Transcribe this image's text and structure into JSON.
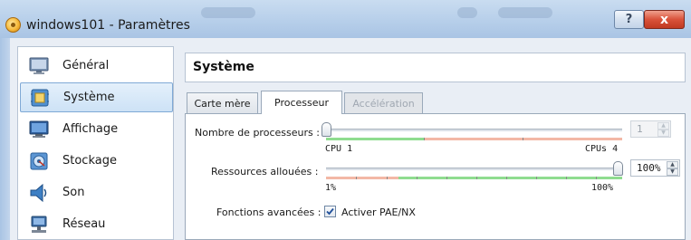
{
  "window": {
    "title": "windows101 - Paramètres",
    "help_label": "?",
    "close_label": "x",
    "colors": {
      "titlebar": "#b7cfea",
      "close": "#d9523a",
      "selection": "#cde2f6"
    }
  },
  "sidebar": {
    "items": [
      {
        "label": "Général",
        "icon": "general-monitor-icon",
        "selected": false
      },
      {
        "label": "Système",
        "icon": "system-chip-icon",
        "selected": true
      },
      {
        "label": "Affichage",
        "icon": "display-icon",
        "selected": false
      },
      {
        "label": "Stockage",
        "icon": "storage-icon",
        "selected": false
      },
      {
        "label": "Son",
        "icon": "speaker-icon",
        "selected": false
      },
      {
        "label": "Réseau",
        "icon": "network-icon",
        "selected": false
      }
    ]
  },
  "main": {
    "title": "Système",
    "tabs": [
      {
        "label": "Carte mère",
        "active": false,
        "enabled": true
      },
      {
        "label": "Processeur",
        "active": true,
        "enabled": true
      },
      {
        "label": "Accélération",
        "active": false,
        "enabled": false
      }
    ],
    "processors": {
      "label": "Nombre de processeurs :",
      "value": 1,
      "min": 1,
      "max": 4,
      "spin_value": "1",
      "spin_enabled": false,
      "min_label": "CPU 1",
      "max_label": "CPUs 4"
    },
    "resources": {
      "label": "Ressources allouées :",
      "value": 100,
      "min": 1,
      "max": 100,
      "spin_value": "100%",
      "min_label": "1%",
      "max_label": "100%"
    },
    "advanced": {
      "label": "Fonctions avancées :",
      "checkbox_label": "Activer PAE/NX",
      "checked": true
    }
  }
}
